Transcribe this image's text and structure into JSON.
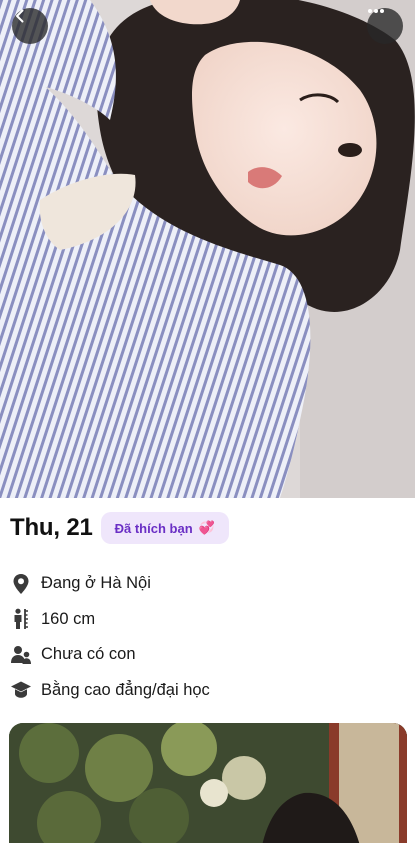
{
  "profile": {
    "name_age": "Thu, 21",
    "liked_badge": "Đã thích bạn",
    "liked_badge_emoji": "💞"
  },
  "info": [
    {
      "icon": "location-pin-icon",
      "text": "Đang ở Hà Nội"
    },
    {
      "icon": "height-icon",
      "text": "160 cm"
    },
    {
      "icon": "children-icon",
      "text": "Chưa có con"
    },
    {
      "icon": "graduation-cap-icon",
      "text": "Bằng cao đẳng/đại học"
    }
  ],
  "colors": {
    "badge_bg": "#efe6fb",
    "badge_text": "#6a2fc5",
    "icon": "#3a3a3a"
  }
}
